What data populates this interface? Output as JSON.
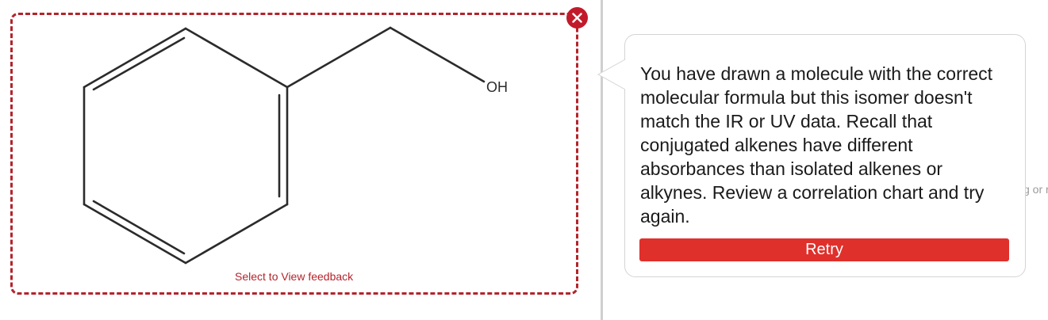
{
  "answer_area": {
    "atom_label": "OH",
    "select_feedback_label": "Select to View feedback"
  },
  "feedback": {
    "message": "You have drawn a molecule with the correct molecular formula but this isomer doesn't match the IR or UV data. Recall that conjugated alkenes have different absorbances than isolated alkenes or alkynes. Review a correlation chart and try again.",
    "retry_label": "Retry"
  },
  "background": {
    "partial_text": "g or r"
  },
  "colors": {
    "accent_red": "#b3242c",
    "close_red": "#c21a2a",
    "retry_red": "#e0302b"
  },
  "icons": {
    "close": "close-icon"
  }
}
